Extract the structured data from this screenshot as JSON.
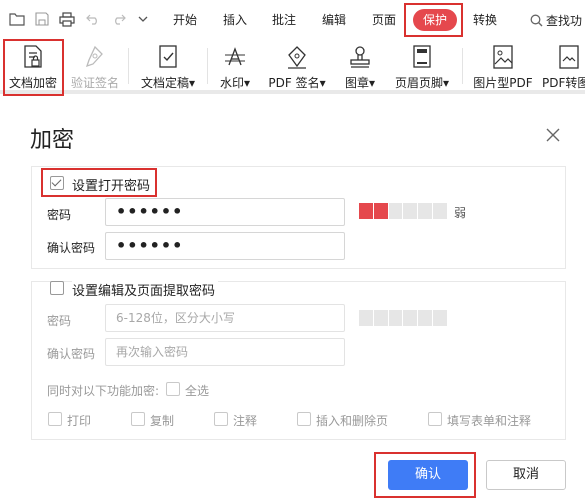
{
  "toolbar": {
    "quick_access_icons": [
      "folder-icon",
      "save-icon",
      "print-icon",
      "undo-icon",
      "redo-icon",
      "dropdown-arrow-icon"
    ],
    "menu_tabs": [
      "开始",
      "插入",
      "批注",
      "编辑",
      "页面",
      "保护",
      "转换"
    ],
    "active_tab": "保护",
    "search_label": "查找功"
  },
  "ribbon": {
    "items": [
      {
        "label": "文档加密",
        "icon": "document-lock-icon",
        "enabled": true
      },
      {
        "label": "验证签名",
        "icon": "pen-nib-icon",
        "enabled": false
      },
      {
        "label": "文档定稿",
        "icon": "document-check-icon",
        "enabled": true,
        "dropdown": true
      },
      {
        "label": "水印",
        "icon": "watermark-icon",
        "enabled": true,
        "dropdown": true
      },
      {
        "label": "PDF 签名",
        "icon": "pdf-sign-icon",
        "enabled": true,
        "dropdown": true
      },
      {
        "label": "图章",
        "icon": "stamp-icon",
        "enabled": true,
        "dropdown": true
      },
      {
        "label": "页眉页脚",
        "icon": "header-footer-icon",
        "enabled": true,
        "dropdown": true
      },
      {
        "label": "图片型PDF",
        "icon": "image-pdf-icon",
        "enabled": true
      },
      {
        "label": "PDF转图",
        "icon": "pdf-to-image-icon",
        "enabled": true
      }
    ]
  },
  "dialog": {
    "title": "加密",
    "open_password": {
      "checkbox_label": "设置打开密码",
      "checked": true,
      "password_label": "密码",
      "password_value": "••••••",
      "strength_label": "弱",
      "strength_level": 2,
      "strength_total": 6,
      "confirm_label": "确认密码",
      "confirm_value": "••••••"
    },
    "edit_password": {
      "checkbox_label": "设置编辑及页面提取密码",
      "checked": false,
      "password_label": "密码",
      "password_placeholder": "6-128位，区分大小写",
      "confirm_label": "确认密码",
      "confirm_placeholder": "再次输入密码",
      "features_label": "同时对以下功能加密:",
      "select_all_label": "全选",
      "options": [
        "打印",
        "复制",
        "注释",
        "插入和删除页",
        "填写表单和注释"
      ]
    },
    "buttons": {
      "ok": "确认",
      "cancel": "取消"
    }
  },
  "colors": {
    "accent_red": "#e5484d",
    "highlight_border": "#d9312f",
    "primary_blue": "#3f7cf6"
  }
}
